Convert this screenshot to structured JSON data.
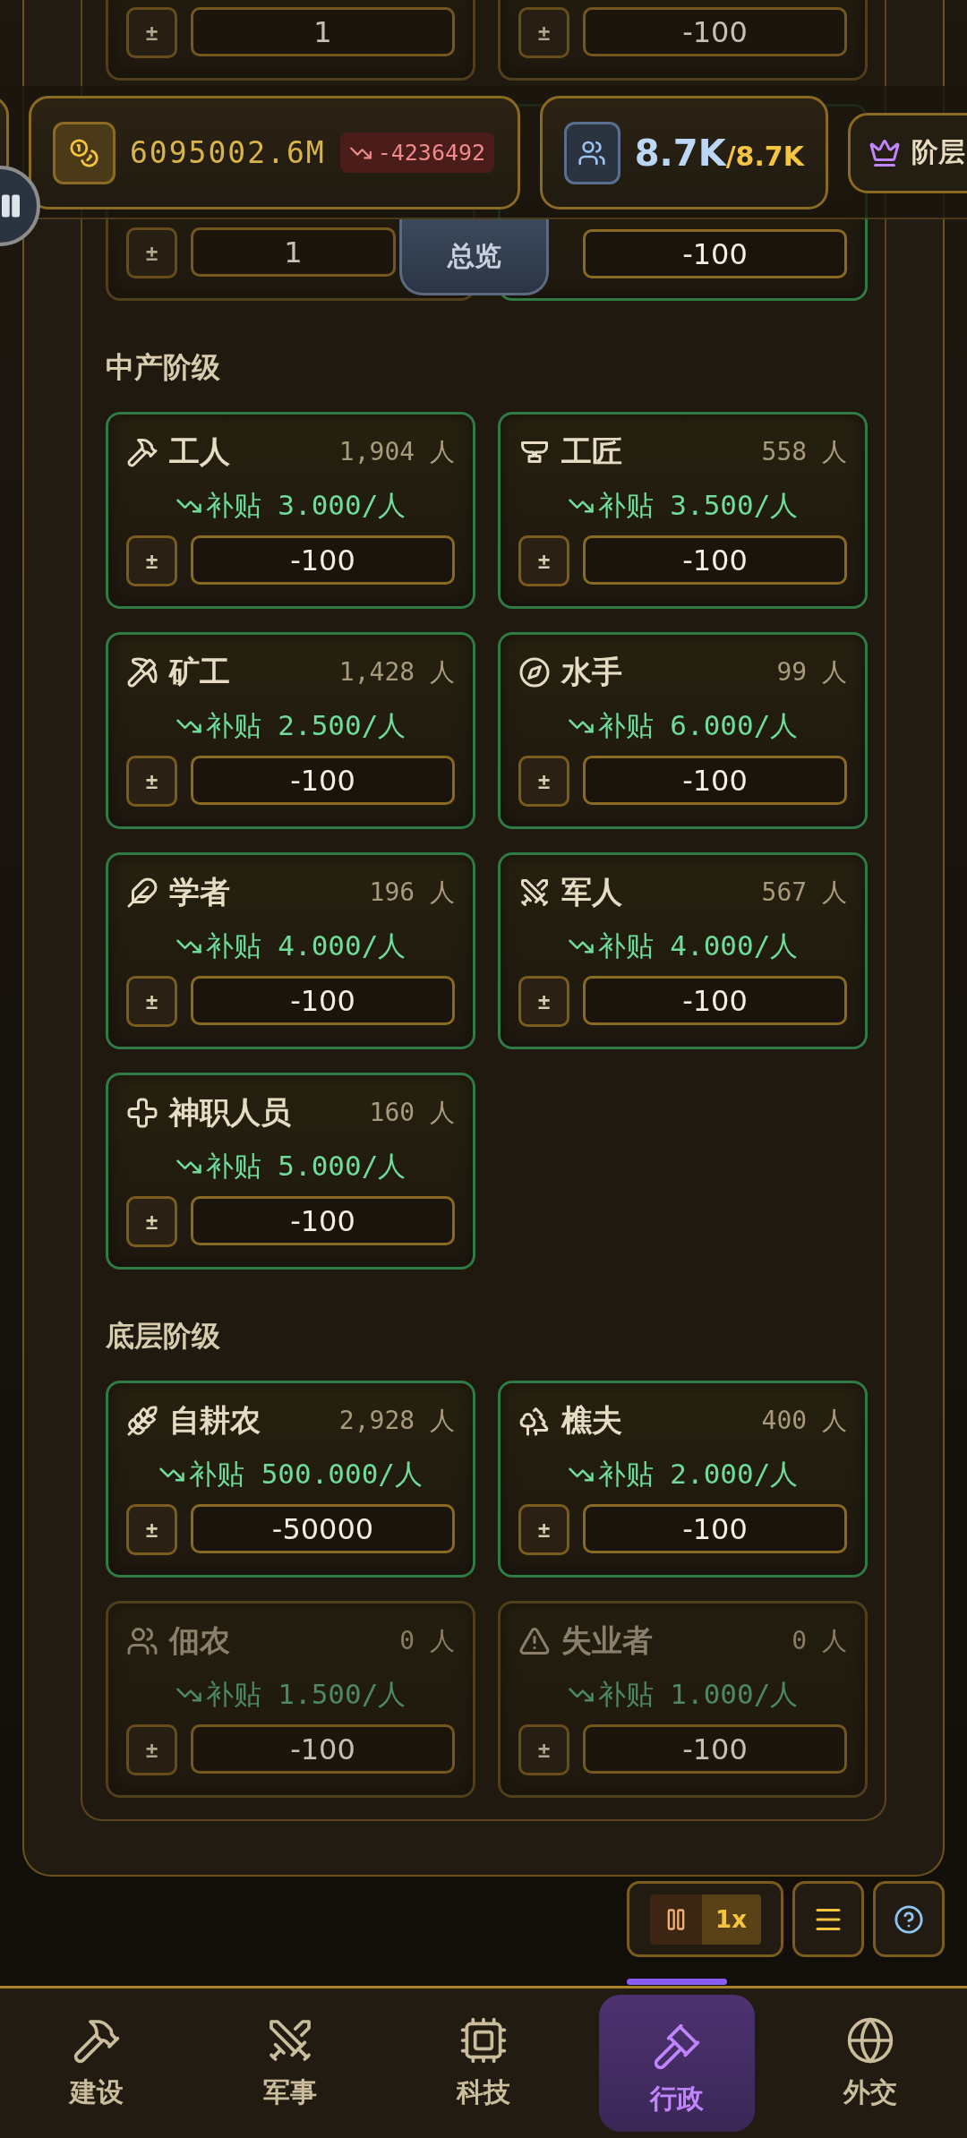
{
  "header": {
    "treasury": {
      "value": "6095002.6M",
      "change": "-4236492"
    },
    "population": {
      "current": "8.7K",
      "capacity": "/8.7K"
    },
    "class_button": {
      "label": "阶层"
    }
  },
  "overview_tab": {
    "label": "总览"
  },
  "partial_cards": [
    {
      "step_button": "±",
      "value": "1",
      "active": false
    },
    {
      "step_button": "±",
      "value": "-100",
      "active": false
    },
    {
      "step_button": "±",
      "value": "1",
      "active": false
    },
    {
      "value": "-100",
      "active": true
    }
  ],
  "sections": [
    {
      "title": "中产阶级",
      "cards": [
        {
          "name": "工人",
          "count": "1,904",
          "unit": "人",
          "subsidy": "补贴 3.000/人",
          "step_button": "±",
          "value": "-100",
          "active": true
        },
        {
          "name": "工匠",
          "count": "558",
          "unit": "人",
          "subsidy": "补贴 3.500/人",
          "step_button": "±",
          "value": "-100",
          "active": true
        },
        {
          "name": "矿工",
          "count": "1,428",
          "unit": "人",
          "subsidy": "补贴 2.500/人",
          "step_button": "±",
          "value": "-100",
          "active": true
        },
        {
          "name": "水手",
          "count": "99",
          "unit": "人",
          "subsidy": "补贴 6.000/人",
          "step_button": "±",
          "value": "-100",
          "active": true
        },
        {
          "name": "学者",
          "count": "196",
          "unit": "人",
          "subsidy": "补贴 4.000/人",
          "step_button": "±",
          "value": "-100",
          "active": true
        },
        {
          "name": "军人",
          "count": "567",
          "unit": "人",
          "subsidy": "补贴 4.000/人",
          "step_button": "±",
          "value": "-100",
          "active": true
        },
        {
          "name": "神职人员",
          "count": "160",
          "unit": "人",
          "subsidy": "补贴 5.000/人",
          "step_button": "±",
          "value": "-100",
          "active": true
        }
      ]
    },
    {
      "title": "底层阶级",
      "cards": [
        {
          "name": "自耕农",
          "count": "2,928",
          "unit": "人",
          "subsidy": "补贴 500.000/人",
          "step_button": "±",
          "value": "-50000",
          "active": true
        },
        {
          "name": "樵夫",
          "count": "400",
          "unit": "人",
          "subsidy": "补贴 2.000/人",
          "step_button": "±",
          "value": "-100",
          "active": true
        },
        {
          "name": "佃农",
          "count": "0",
          "unit": "人",
          "subsidy": "补贴 1.500/人",
          "step_button": "±",
          "value": "-100",
          "active": false
        },
        {
          "name": "失业者",
          "count": "0",
          "unit": "人",
          "subsidy": "补贴 1.000/人",
          "step_button": "±",
          "value": "-100",
          "active": false
        }
      ]
    }
  ],
  "controls": {
    "speed": "1x"
  },
  "nav": [
    {
      "label": "建设",
      "selected": false
    },
    {
      "label": "军事",
      "selected": false
    },
    {
      "label": "科技",
      "selected": false
    },
    {
      "label": "行政",
      "selected": true
    },
    {
      "label": "外交",
      "selected": false
    }
  ]
}
